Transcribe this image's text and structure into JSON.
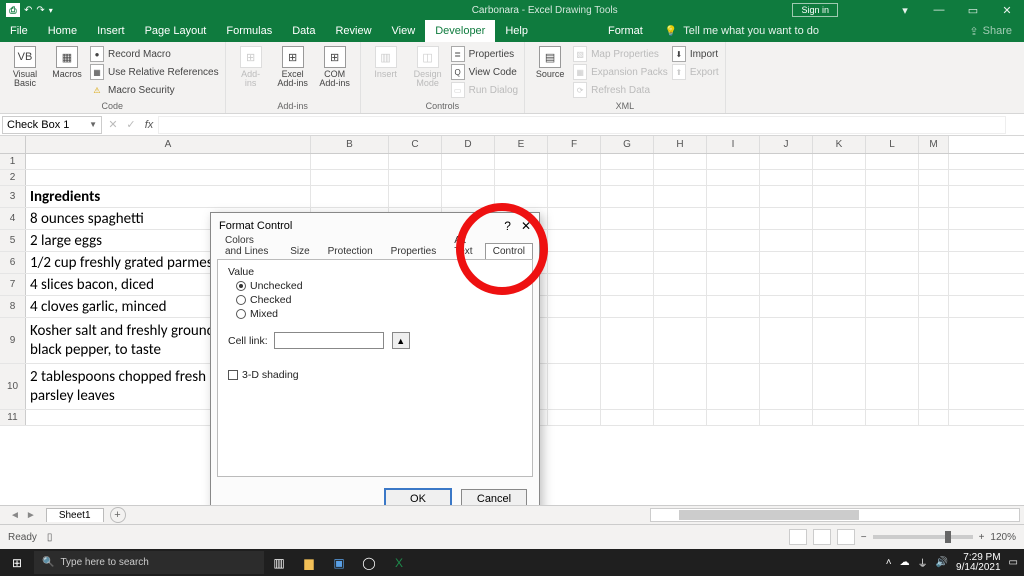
{
  "titlebar": {
    "doc_title": "Carbonara - Excel",
    "context_title": "Drawing Tools",
    "signin": "Sign in",
    "min": "—",
    "restore": "▭",
    "close": "✕",
    "ribbon_opts": "▾"
  },
  "tabs": {
    "list": [
      "File",
      "Home",
      "Insert",
      "Page Layout",
      "Formulas",
      "Data",
      "Review",
      "View",
      "Developer",
      "Help",
      "Format"
    ],
    "active": "Developer",
    "tellme_icon": "💡",
    "tellme": "Tell me what you want to do",
    "share": "Share"
  },
  "ribbon": {
    "group1_label": "Code",
    "vb_label": "Visual\nBasic",
    "macros_label": "Macros",
    "record": "Record Macro",
    "relrefs": "Use Relative References",
    "macsec": "Macro Security",
    "group2_label": "Add-ins",
    "addins": "Add-\nins",
    "exceladdins": "Excel\nAdd-ins",
    "comaddins": "COM\nAdd-ins",
    "group3_label": "Controls",
    "insert": "Insert",
    "design": "Design\nMode",
    "properties": "Properties",
    "viewcode": "View Code",
    "rundlg": "Run Dialog",
    "group4_label": "XML",
    "source": "Source",
    "mapprops": "Map Properties",
    "exppacks": "Expansion Packs",
    "refresh": "Refresh Data",
    "import": "Import",
    "export": "Export"
  },
  "fbar": {
    "name": "Check Box 1",
    "fx": "fx"
  },
  "columns": [
    "A",
    "B",
    "C",
    "D",
    "E",
    "F",
    "G",
    "H",
    "I",
    "J",
    "K",
    "L",
    "M"
  ],
  "rows": {
    "heights": [
      16,
      16,
      22,
      22,
      22,
      22,
      22,
      22,
      46,
      46,
      16
    ],
    "labels": [
      "1",
      "2",
      "3",
      "4",
      "5",
      "6",
      "7",
      "8",
      "9",
      "10",
      "11"
    ],
    "cells": {
      "A3": "Ingredients",
      "A4": "8 ounces spaghetti",
      "A5": "2 large eggs",
      "A6": "1/2 cup freshly grated parmesan",
      "A7": "4 slices bacon, diced",
      "A8": "4 cloves garlic, minced",
      "A9": "Kosher salt and freshly ground\nblack pepper, to taste",
      "A10": "2 tablespoons chopped fresh\nparsley leaves"
    }
  },
  "dialog": {
    "title": "Format Control",
    "help": "?",
    "close": "✕",
    "tabs": [
      "Colors and Lines",
      "Size",
      "Protection",
      "Properties",
      "Alt Text",
      "Control"
    ],
    "active_tab": "Control",
    "value_label": "Value",
    "opt_unchecked": "Unchecked",
    "opt_checked": "Checked",
    "opt_mixed": "Mixed",
    "celllink": "Cell link:",
    "shading": "3-D shading",
    "ok": "OK",
    "cancel": "Cancel"
  },
  "sheetbar": {
    "sheet": "Sheet1"
  },
  "statusbar": {
    "ready": "Ready",
    "zoom": "120%"
  },
  "wtb": {
    "search_placeholder": "Type here to search",
    "time": "7:29 PM",
    "date": "9/14/2021"
  }
}
